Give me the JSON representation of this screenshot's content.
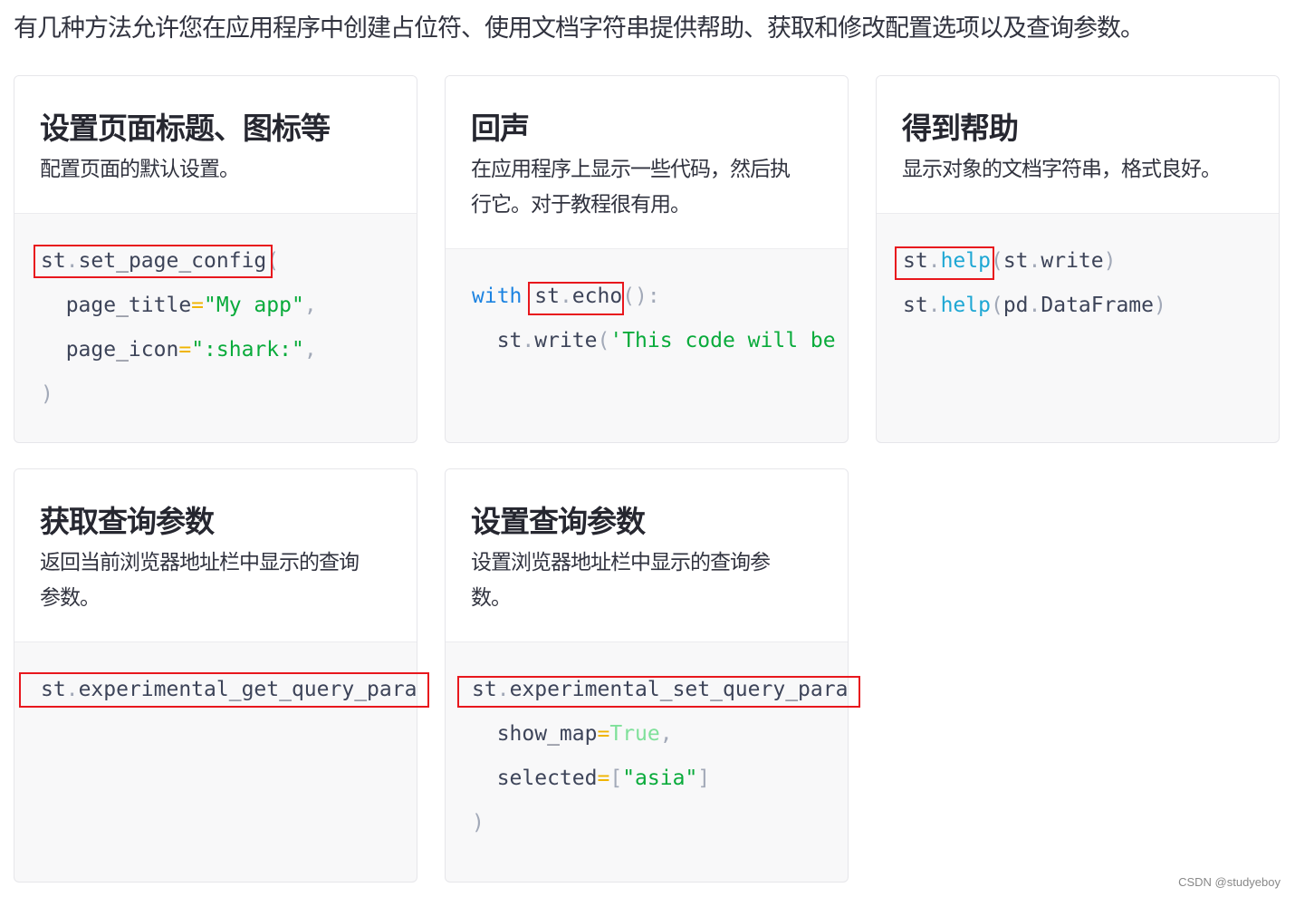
{
  "intro": "有几种方法允许您在应用程序中创建占位符、使用文档字符串提供帮助、获取和修改配置选项以及查询参数。",
  "colors": {
    "punct": "#a2a9b8",
    "operator": "#f0b400",
    "string": "#09ab3b",
    "keyword": "#1c83e1",
    "bool": "#7fe09a",
    "func": "#1ea7d4",
    "highlight": "#e8171d"
  },
  "cards": [
    {
      "title": "设置页面标题、图标等",
      "desc": [
        "配置页面的默认设置。"
      ],
      "code": [
        [
          [
            "st",
            "n"
          ],
          [
            ".",
            "p"
          ],
          [
            "set_page_config",
            "n"
          ],
          [
            "(",
            "p"
          ]
        ],
        [
          [
            "  page_title",
            "n"
          ],
          [
            "=",
            "o"
          ],
          [
            "\"My app\"",
            "s"
          ],
          [
            ",",
            "p"
          ]
        ],
        [
          [
            "  page_icon",
            "n"
          ],
          [
            "=",
            "o"
          ],
          [
            "\":shark:\"",
            "s"
          ],
          [
            ",",
            "p"
          ]
        ],
        [
          [
            ")",
            "p"
          ]
        ]
      ]
    },
    {
      "title": "回声",
      "desc": [
        "在应用程序上显示一些代码，然后执",
        "行它。对于教程很有用。"
      ],
      "code": [
        [
          [
            "with",
            "k"
          ],
          [
            " st",
            "n"
          ],
          [
            ".",
            "p"
          ],
          [
            "echo",
            "n"
          ],
          [
            "():",
            "p"
          ]
        ],
        [
          [
            "  st",
            "n"
          ],
          [
            ".",
            "p"
          ],
          [
            "write",
            "n"
          ],
          [
            "(",
            "p"
          ],
          [
            "'This code will be",
            "s"
          ]
        ]
      ]
    },
    {
      "title": "得到帮助",
      "desc": [
        "显示对象的文档字符串，格式良好。"
      ],
      "code": [
        [
          [
            "st",
            "n"
          ],
          [
            ".",
            "p"
          ],
          [
            "help",
            "f"
          ],
          [
            "(",
            "p"
          ],
          [
            "st",
            "n"
          ],
          [
            ".",
            "p"
          ],
          [
            "write",
            "n"
          ],
          [
            ")",
            "p"
          ]
        ],
        [
          [
            "st",
            "n"
          ],
          [
            ".",
            "p"
          ],
          [
            "help",
            "f"
          ],
          [
            "(",
            "p"
          ],
          [
            "pd",
            "n"
          ],
          [
            ".",
            "p"
          ],
          [
            "DataFrame",
            "n"
          ],
          [
            ")",
            "p"
          ]
        ]
      ]
    },
    {
      "title": "获取查询参数",
      "desc": [
        "返回当前浏览器地址栏中显示的查询",
        "参数。"
      ],
      "code": [
        [
          [
            "st",
            "n"
          ],
          [
            ".",
            "p"
          ],
          [
            "experimental_get_query_params",
            "n"
          ]
        ]
      ]
    },
    {
      "title": "设置查询参数",
      "desc": [
        "设置浏览器地址栏中显示的查询参",
        "数。"
      ],
      "code": [
        [
          [
            "st",
            "n"
          ],
          [
            ".",
            "p"
          ],
          [
            "experimental_set_query_params",
            "n"
          ]
        ],
        [
          [
            "  show_map",
            "n"
          ],
          [
            "=",
            "o"
          ],
          [
            "True",
            "b"
          ],
          [
            ",",
            "p"
          ]
        ],
        [
          [
            "  selected",
            "n"
          ],
          [
            "=",
            "o"
          ],
          [
            "[",
            "p"
          ],
          [
            "\"asia\"",
            "s"
          ],
          [
            "]",
            "p"
          ]
        ],
        [
          [
            ")",
            "p"
          ]
        ]
      ]
    }
  ],
  "watermark": "CSDN @studyeboy"
}
